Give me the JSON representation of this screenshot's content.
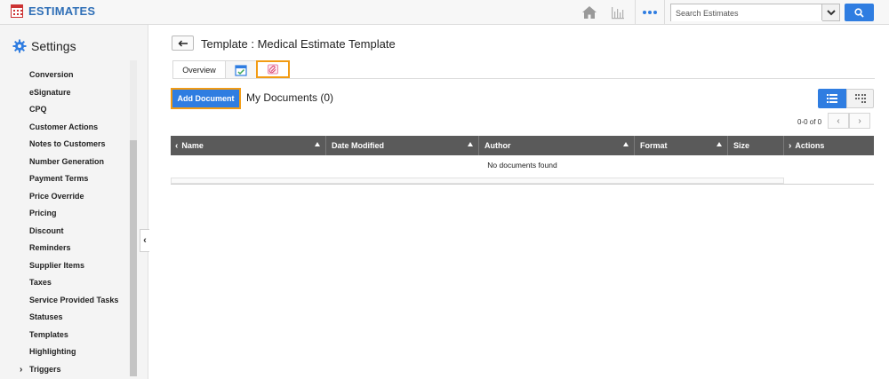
{
  "app": {
    "title": "ESTIMATES"
  },
  "topbar": {
    "search_placeholder": "Search Estimates",
    "icons": [
      "home-icon",
      "chart-icon",
      "more-dots-icon",
      "dropdown-chevron-icon",
      "search-icon"
    ]
  },
  "sidebar": {
    "title": "Settings",
    "items": [
      {
        "label": "Conversion"
      },
      {
        "label": "eSignature"
      },
      {
        "label": "CPQ"
      },
      {
        "label": "Customer Actions"
      },
      {
        "label": "Notes to Customers"
      },
      {
        "label": "Number Generation"
      },
      {
        "label": "Payment Terms"
      },
      {
        "label": "Price Override"
      },
      {
        "label": "Pricing"
      },
      {
        "label": "Discount"
      },
      {
        "label": "Reminders"
      },
      {
        "label": "Supplier Items"
      },
      {
        "label": "Taxes"
      },
      {
        "label": "Service Provided Tasks"
      },
      {
        "label": "Statuses"
      },
      {
        "label": "Templates"
      },
      {
        "label": "Highlighting"
      },
      {
        "label": "Triggers",
        "expandable": true
      }
    ]
  },
  "main": {
    "title": "Template : Medical Estimate Template",
    "tabs": [
      {
        "label": "Overview"
      },
      {
        "label": "",
        "icon": "calendar-check-icon"
      },
      {
        "label": "",
        "icon": "attachment-icon",
        "active": true
      }
    ],
    "add_button": "Add Document",
    "section_title": "My Documents (0)",
    "pager": {
      "text": "0-0 of 0"
    },
    "grid": {
      "columns": [
        "Name",
        "Date Modified",
        "Author",
        "Format",
        "Size",
        "Actions"
      ],
      "empty_message": "No documents found"
    }
  },
  "colors": {
    "brand_blue": "#2f6fb7",
    "accent_blue": "#2f7de1",
    "highlight_orange": "#f29b13",
    "grid_header": "#5a5a5a"
  }
}
